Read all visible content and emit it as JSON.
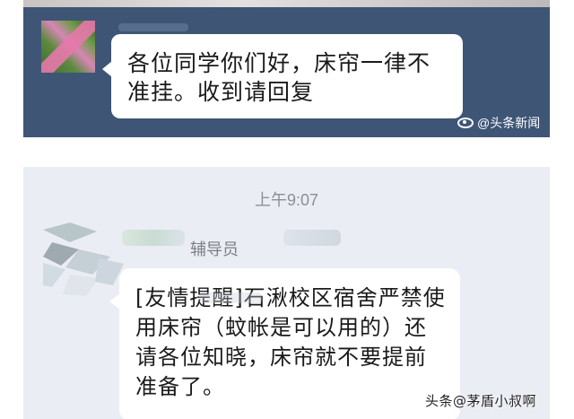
{
  "top_chat": {
    "message": "各位同学你们好，床帘一律不准挂。收到请回复",
    "watermark": "@头条新闻"
  },
  "bottom_chat": {
    "timestamp": "上午9:07",
    "sender": "辅导员",
    "message": "[友情提醒]石湫校区宿舍严禁使用床帘（蚊帐是可以用的）还请各位知晓，床帘就不要提前准备了。"
  },
  "source_watermark": "头条@茅盾小叔啊",
  "colors": {
    "top_chat_background": "#3e5576",
    "bottom_chat_background": "#ebedf5",
    "bubble": "#ffffff"
  },
  "icons": [
    "weibo-logo-icon",
    "avatar-image"
  ]
}
